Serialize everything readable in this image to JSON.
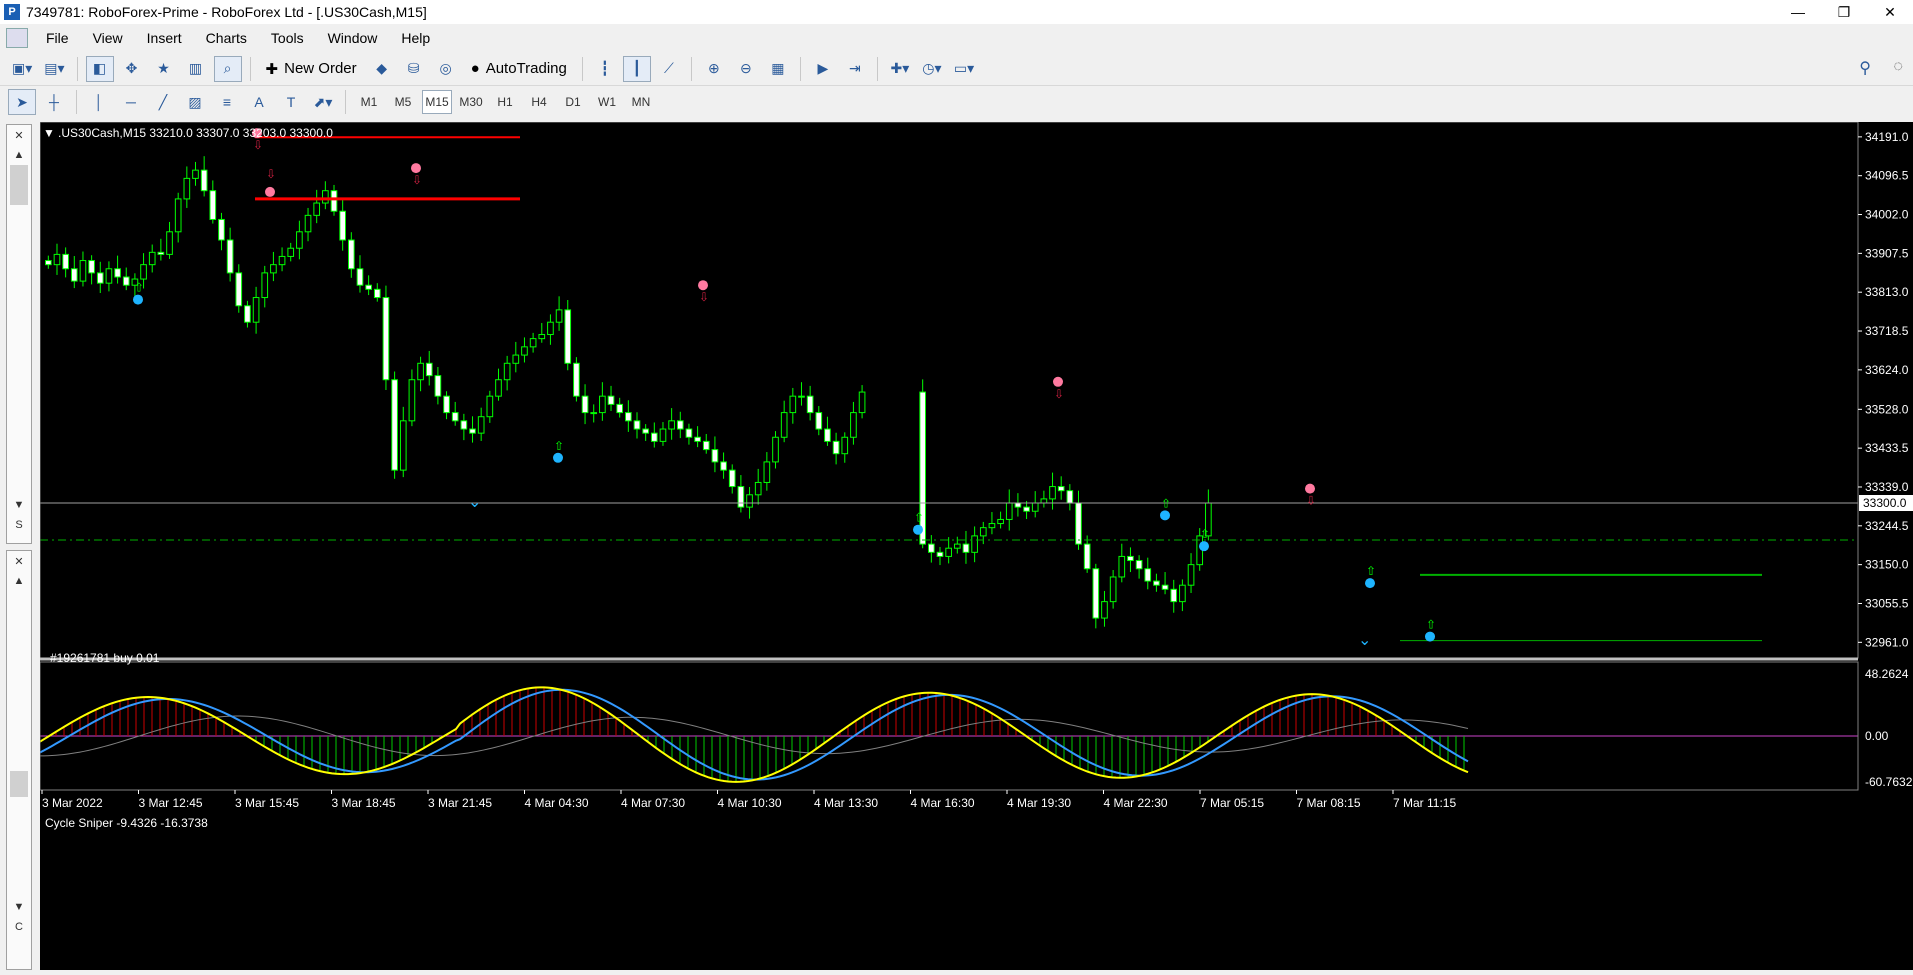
{
  "window": {
    "title": "7349781: RoboForex-Prime - RoboForex Ltd - [.US30Cash,M15]",
    "app_icon": "P",
    "controls": {
      "minimize": "—",
      "restore": "❐",
      "close": "✕"
    }
  },
  "menu": {
    "items": [
      "File",
      "View",
      "Insert",
      "Charts",
      "Tools",
      "Window",
      "Help"
    ]
  },
  "toolbar": {
    "new_order_label": "New Order",
    "autotrading_label": "AutoTrading"
  },
  "timeframes": {
    "items": [
      "M1",
      "M5",
      "M15",
      "M30",
      "H1",
      "H4",
      "D1",
      "W1",
      "MN"
    ],
    "active": "M15"
  },
  "left_panel": {
    "tab1": "S",
    "tab2": "C"
  },
  "chart": {
    "header": ".US30Cash,M15  33210.0 33307.0 33203.0 33300.0",
    "current_price": "33300.0",
    "order_label": "#19261781 buy 0.01",
    "price_ticks": [
      "34191.0",
      "34096.5",
      "34002.0",
      "33907.5",
      "33813.0",
      "33718.5",
      "33624.0",
      "33528.0",
      "33433.5",
      "33339.0",
      "33244.5",
      "33150.0",
      "33055.5",
      "32961.0"
    ],
    "time_ticks": [
      "3 Mar 2022",
      "3 Mar 12:45",
      "3 Mar 15:45",
      "3 Mar 18:45",
      "3 Mar 21:45",
      "4 Mar 04:30",
      "4 Mar 07:30",
      "4 Mar 10:30",
      "4 Mar 13:30",
      "4 Mar 16:30",
      "4 Mar 19:30",
      "4 Mar 22:30",
      "7 Mar 05:15",
      "7 Mar 08:15",
      "7 Mar 11:15"
    ],
    "colors": {
      "bull": "#00ff00",
      "bear_body": "#ffffff",
      "wick": "#00ff00",
      "level": "#ff0000",
      "order_line": "#00b000",
      "buy_dot": "#1eb4ff",
      "sell_dot": "#ff7aa0"
    }
  },
  "indicator": {
    "header": "Cycle Sniper -9.4326 -16.3738",
    "ticks": [
      "48.2624",
      "0.00",
      "-60.7632"
    ],
    "colors": {
      "fast": "#ffff00",
      "slow": "#3399ff",
      "signal": "#808080",
      "hist_pos": "#cc0000",
      "hist_neg": "#00cc00",
      "zero": "#cc44cc"
    }
  },
  "chart_data": {
    "type": "candlestick",
    "symbol": ".US30Cash",
    "timeframe": "M15",
    "ohlc_header": {
      "open": 33210.0,
      "high": 33307.0,
      "low": 33203.0,
      "close": 33300.0
    },
    "y_range": [
      32935,
      34215
    ],
    "close_path": [
      33880,
      33905,
      33870,
      33840,
      33890,
      33860,
      33835,
      33870,
      33850,
      33830,
      33845,
      33880,
      33910,
      33905,
      33960,
      34040,
      34090,
      34110,
      34060,
      33990,
      33940,
      33860,
      33780,
      33740,
      33800,
      33860,
      33880,
      33900,
      33920,
      33960,
      34000,
      34030,
      34060,
      34010,
      33940,
      33870,
      33830,
      33820,
      33800,
      33600,
      33380,
      33500,
      33600,
      33640,
      33610,
      33560,
      33520,
      33500,
      33480,
      33470,
      33510,
      33560,
      33600,
      33640,
      33660,
      33680,
      33700,
      33710,
      33740,
      33770,
      33640,
      33560,
      33520,
      33520,
      33560,
      33540,
      33520,
      33500,
      33480,
      33470,
      33450,
      33480,
      33500,
      33480,
      33460,
      33450,
      33430,
      33400,
      33380,
      33340,
      33290,
      33320,
      33350,
      33400,
      33460,
      33520,
      33560,
      33560,
      33520,
      33480,
      33450,
      33420,
      33460,
      33520,
      33570,
      33200,
      33180,
      33170,
      33190,
      33200,
      33180,
      33220,
      33240,
      33250,
      33260,
      33300,
      33290,
      33280,
      33300,
      33310,
      33340,
      33330,
      33300,
      33200,
      33140,
      33020,
      33060,
      33120,
      33170,
      33160,
      33140,
      33110,
      33100,
      33090,
      33060,
      33100,
      33150,
      33220,
      33300
    ],
    "sell_signals": 6,
    "buy_signals": 7
  }
}
